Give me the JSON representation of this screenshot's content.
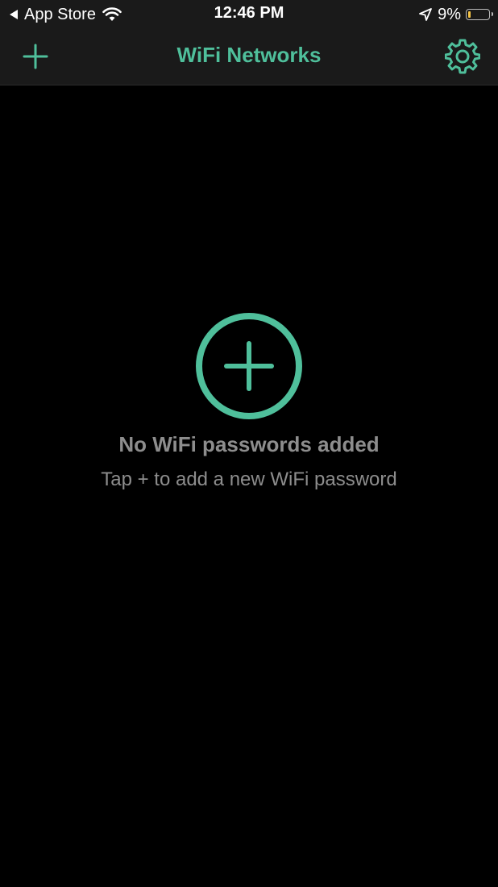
{
  "status_bar": {
    "back_label": "App Store",
    "time": "12:46 PM",
    "battery_percent": "9%",
    "battery_level": 0.09,
    "icons": [
      "back-arrow-icon",
      "wifi-icon",
      "location-arrow-icon",
      "battery-icon"
    ]
  },
  "nav": {
    "title": "WiFi Networks",
    "left_icon": "plus-icon",
    "right_icon": "gear-icon"
  },
  "empty_state": {
    "icon": "plus-circle-icon",
    "title": "No WiFi passwords added",
    "subtitle": "Tap + to add a new WiFi password"
  },
  "colors": {
    "accent": "#4fbf9b",
    "background": "#000000",
    "bar_background": "#1a1a1a",
    "muted_text": "#8d8d8d",
    "battery_low": "#f6c445"
  }
}
